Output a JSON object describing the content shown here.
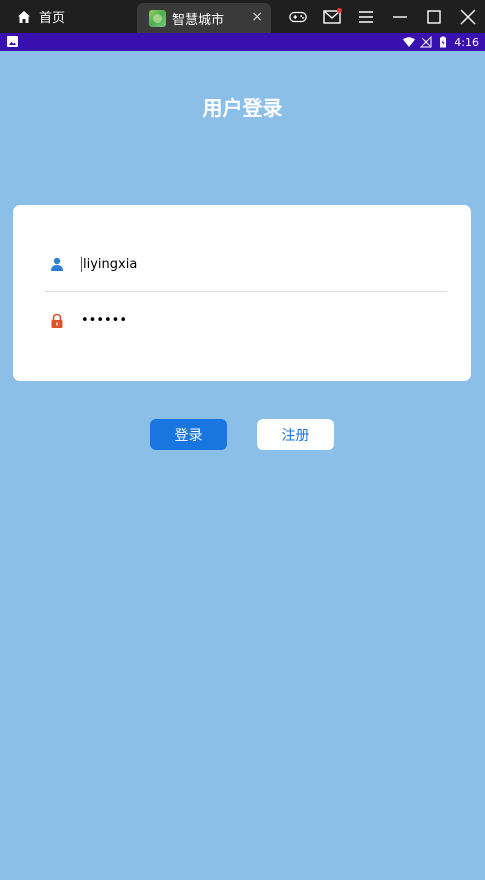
{
  "chrome": {
    "home_tab_label": "首页",
    "app_tab_label": "智慧城市",
    "tab_close_glyph": "×",
    "icons": [
      "home-icon",
      "app-icon",
      "gamepad-icon",
      "mail-icon",
      "menu-icon",
      "minimize-icon",
      "maximize-icon",
      "close-icon"
    ]
  },
  "statusbar": {
    "time": "4:16",
    "icons": [
      "image-notification-icon",
      "wifi-icon",
      "no-signal-icon",
      "battery-icon"
    ]
  },
  "page": {
    "title": "用户登录"
  },
  "form": {
    "username": {
      "value": "liyingxia",
      "icon": "user-icon",
      "icon_color": "#2f7fd4"
    },
    "password": {
      "value": "••••••",
      "icon": "lock-icon",
      "icon_color": "#e0522b"
    }
  },
  "buttons": {
    "login_label": "登录",
    "register_label": "注册"
  },
  "colors": {
    "background": "#8bbfe8",
    "primary": "#1976e0",
    "statusbar": "#3a0fb0"
  }
}
